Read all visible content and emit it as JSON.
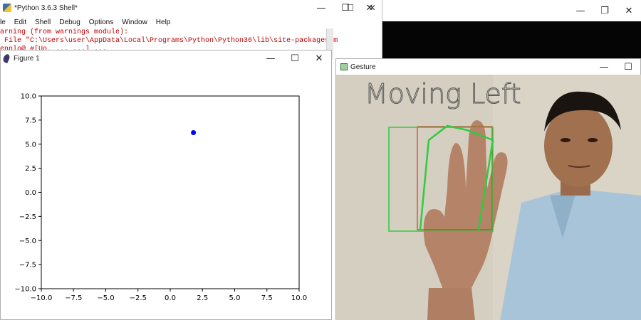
{
  "background_window": {
    "controls": [
      "—",
      "❐",
      "✕"
    ]
  },
  "shell": {
    "title": "*Python 3.6.3 Shell*",
    "controls": [
      "—",
      "☐",
      "✕"
    ],
    "menu": [
      "le",
      "Edit",
      "Shell",
      "Debug",
      "Options",
      "Window",
      "Help"
    ],
    "lines": [
      "arning (from warnings module):",
      " File \"C:\\Users\\user\\AppData\\Local\\Programs\\Python\\Python36\\lib\\site-packages\\m",
      "ennlo@ #[Uo, ... ...] ..."
    ]
  },
  "second_window": {
    "controls": [
      "☐",
      "✕"
    ]
  },
  "figure": {
    "title": "Figure 1",
    "controls": [
      "—",
      "☐",
      "✕"
    ]
  },
  "gesture": {
    "title": "Gesture",
    "controls": [
      "—",
      "☐"
    ],
    "overlay_text": "Moving Left"
  },
  "chart_data": {
    "type": "scatter",
    "title": "",
    "xlabel": "",
    "ylabel": "",
    "xlim": [
      -10.0,
      10.0
    ],
    "ylim": [
      -10.0,
      10.0
    ],
    "xticks": [
      "−10.0",
      "−7.5",
      "−5.0",
      "−2.5",
      "0.0",
      "2.5",
      "5.0",
      "7.5",
      "10.0"
    ],
    "yticks": [
      "10.0",
      "7.5",
      "5.0",
      "2.5",
      "0.0",
      "−2.5",
      "−5.0",
      "−7.5",
      "−10.0"
    ],
    "tick_values": [
      -10,
      -7.5,
      -5,
      -2.5,
      0,
      2.5,
      5,
      7.5,
      10
    ],
    "grid": false,
    "points": [
      {
        "x": 1.8,
        "y": 6.2
      }
    ],
    "point_color": "#0000ff"
  },
  "colors": {
    "shell_text": "#c00000",
    "hull_green": "#2ecc40",
    "rect_red": "#e03030"
  }
}
